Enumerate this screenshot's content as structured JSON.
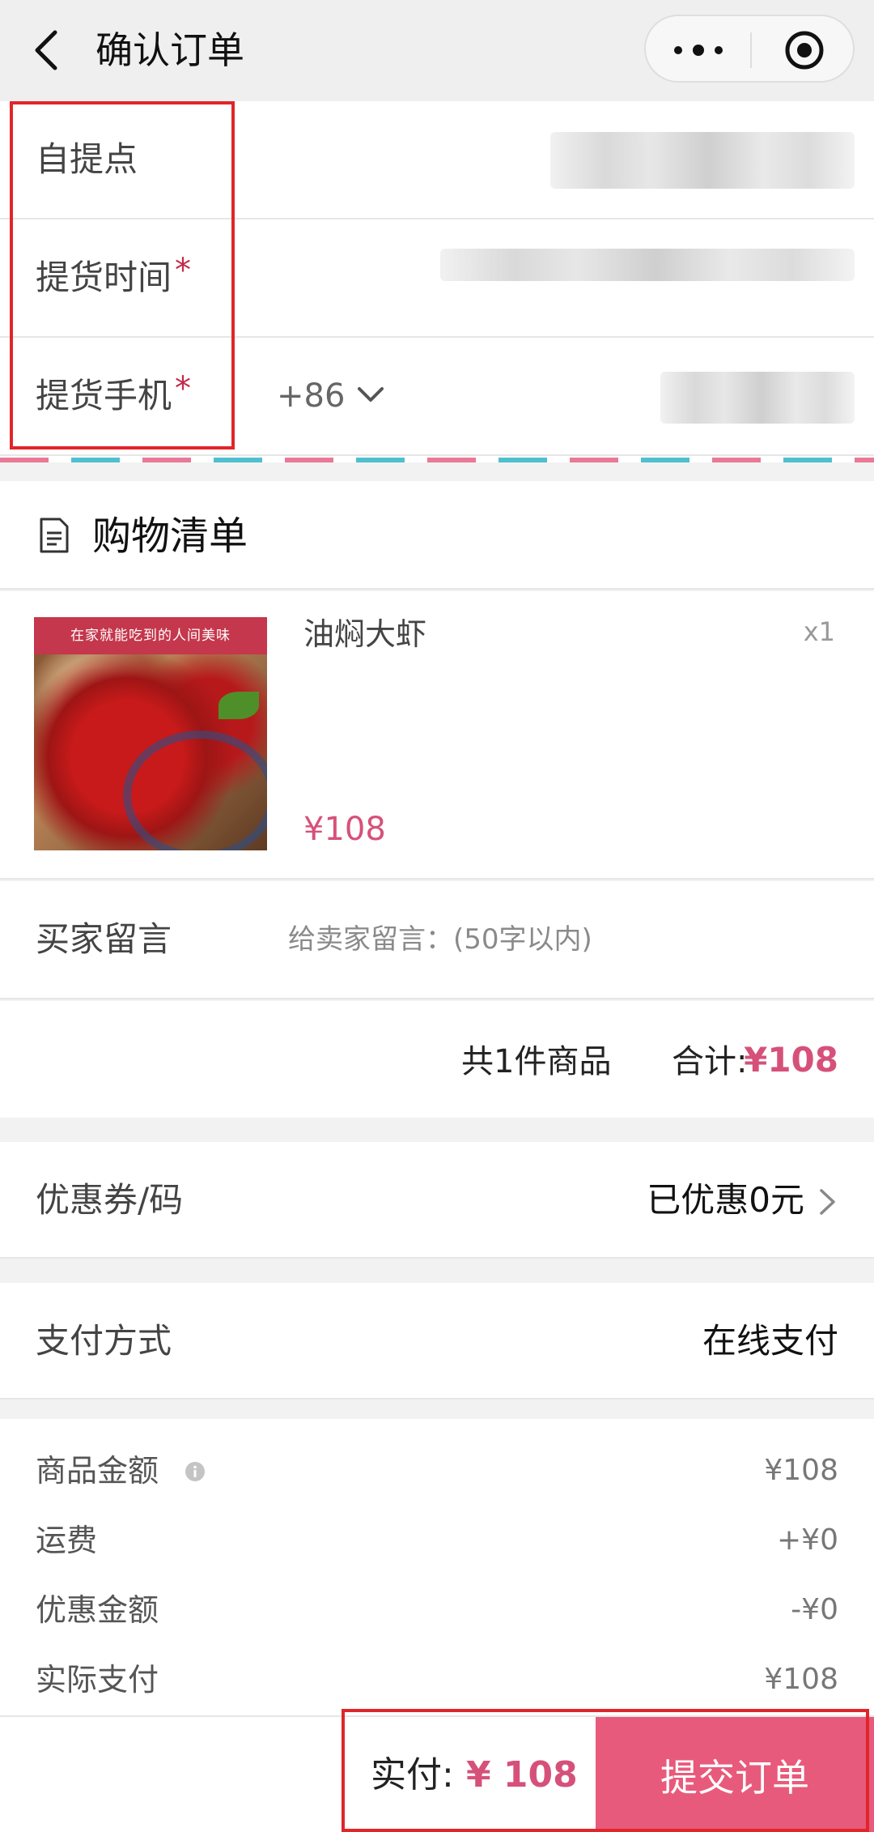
{
  "nav": {
    "title": "确认订单",
    "back_icon": "chevron-left-icon",
    "more_icon": "more-dots-icon",
    "close_icon": "target-icon"
  },
  "pickup": {
    "point_label": "自提点",
    "time_label": "提货时间",
    "phone_label": "提货手机",
    "required_mark": "*",
    "country_code": "+86"
  },
  "cart": {
    "title": "购物清单",
    "icon": "document-icon",
    "item": {
      "name": "油焖大虾",
      "qty": "x1",
      "price": "¥108",
      "image_banner": "在家就能吃到的人间美味"
    }
  },
  "message": {
    "label": "买家留言",
    "placeholder": "给卖家留言：(50字以内)"
  },
  "total": {
    "count_text": "共1件商品",
    "sum_label": "合计:",
    "sum_value": "¥108"
  },
  "coupon": {
    "label": "优惠券/码",
    "value": "已优惠0元"
  },
  "payment": {
    "label": "支付方式",
    "value": "在线支付"
  },
  "summary": [
    {
      "label": "商品金额",
      "value": "¥108"
    },
    {
      "label": "运费",
      "value": "+¥0"
    },
    {
      "label": "优惠金额",
      "value": "-¥0"
    },
    {
      "label": "实际支付",
      "value": "¥108"
    }
  ],
  "footer": {
    "paid_label": "实付:",
    "paid_value": "¥ 108",
    "submit_label": "提交订单"
  },
  "colors": {
    "accent": "#e85a7b",
    "price": "#d6517a",
    "highlight": "#e0262a"
  }
}
